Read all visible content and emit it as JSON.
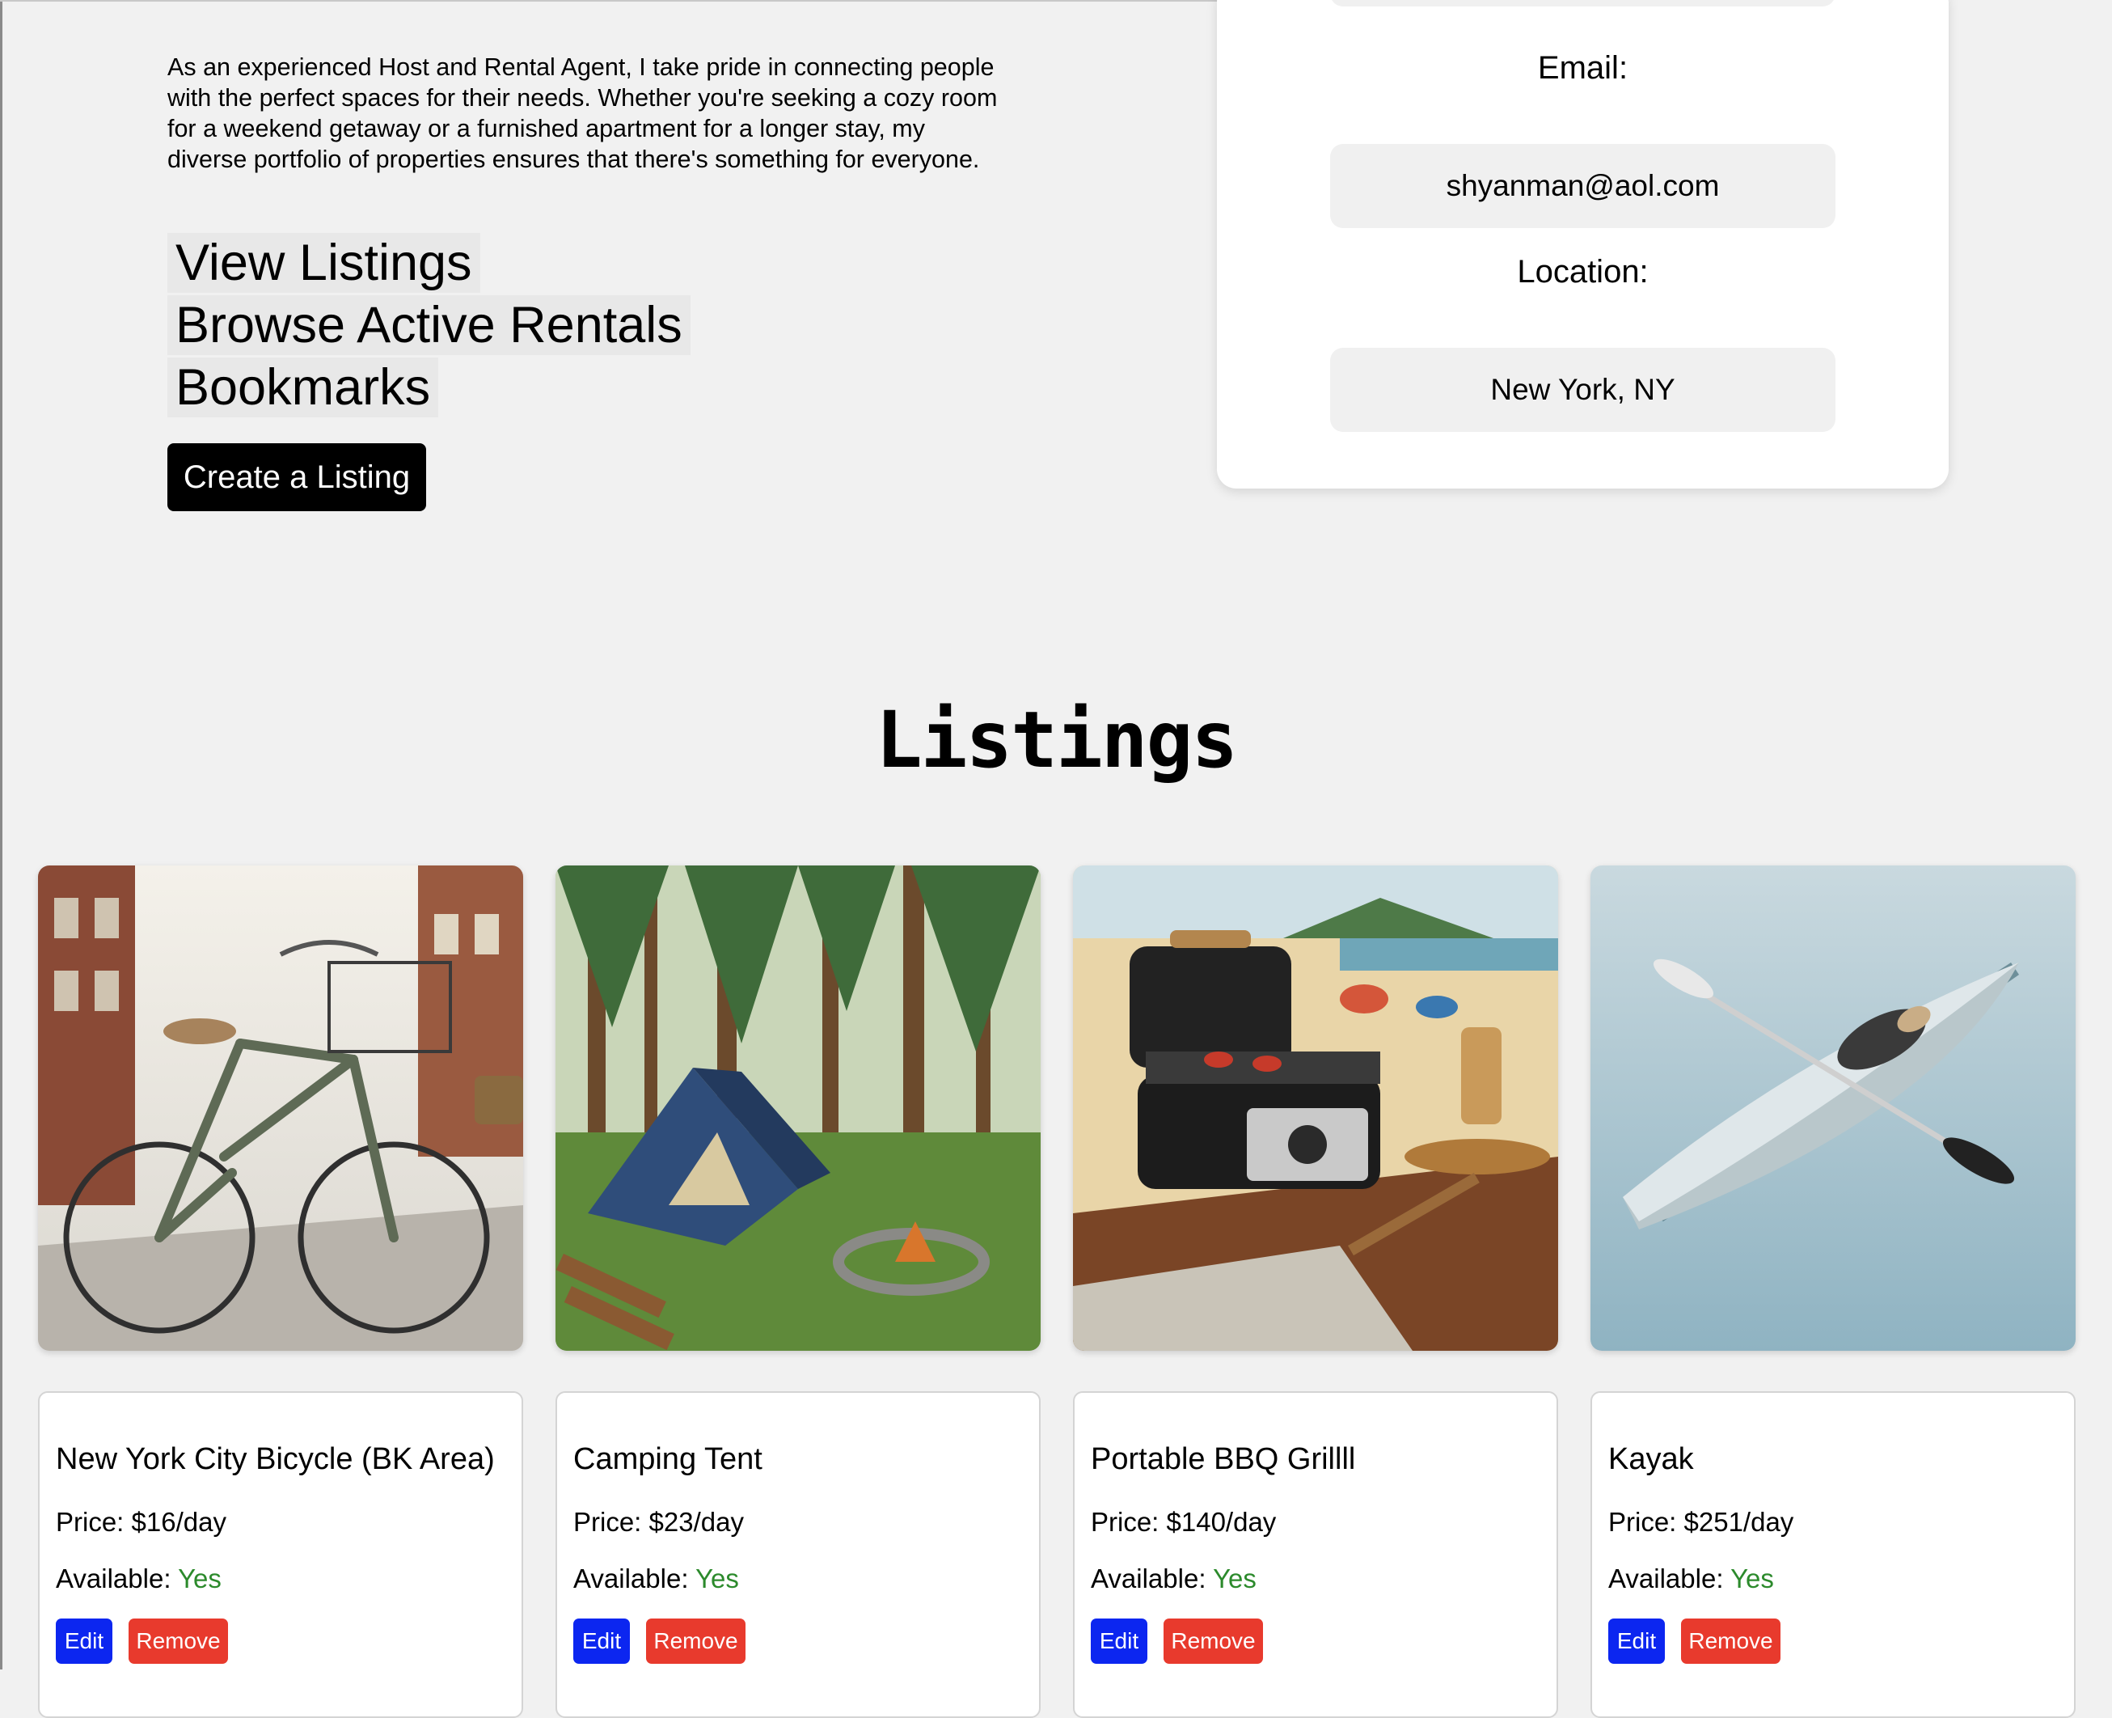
{
  "profile": {
    "bio": "As an experienced Host and Rental Agent, I take pride in connecting people with the perfect spaces for their needs. Whether you're seeking a cozy room for a weekend getaway or a furnished apartment for a longer stay, my diverse portfolio of properties ensures that there's something for everyone.",
    "links": [
      "View Listings",
      "Browse Active Rentals",
      "Bookmarks"
    ],
    "create_button": "Create a Listing",
    "email_label": "Email:",
    "email_value": "shyanman@aol.com",
    "location_label": "Location:",
    "location_value": "New York, NY"
  },
  "listings_section": {
    "title": "Listings",
    "available_label": "Available:",
    "edit_label": "Edit",
    "remove_label": "Remove",
    "items": [
      {
        "title": "New York City Bicycle (BK Area)",
        "price": "Price: $16/day",
        "available": "Yes",
        "image": "bicycle-image"
      },
      {
        "title": "Camping Tent",
        "price": "Price: $23/day",
        "available": "Yes",
        "image": "tent-image"
      },
      {
        "title": "Portable BBQ Grillll",
        "price": "Price: $140/day",
        "available": "Yes",
        "image": "bbq-grill-image"
      },
      {
        "title": "Kayak",
        "price": "Price: $251/day",
        "available": "Yes",
        "image": "kayak-image"
      }
    ]
  },
  "colors": {
    "edit": "#0c26f0",
    "remove": "#e83a2d",
    "available_yes": "#2c8a2c",
    "page_bg": "#f1f1f1"
  }
}
